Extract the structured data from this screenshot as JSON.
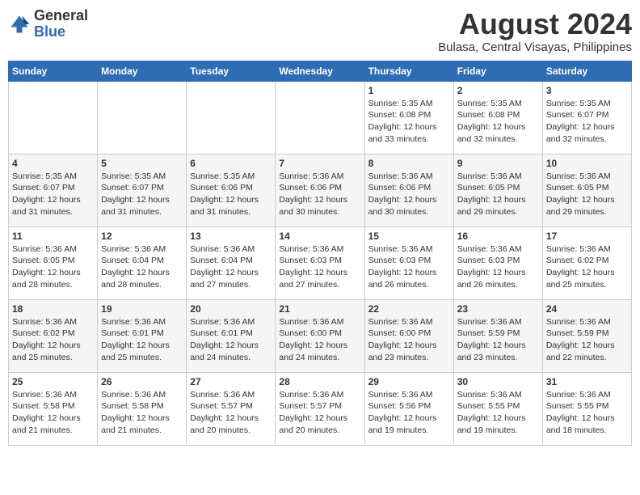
{
  "logo": {
    "general": "General",
    "blue": "Blue"
  },
  "title": "August 2024",
  "subtitle": "Bulasa, Central Visayas, Philippines",
  "days_of_week": [
    "Sunday",
    "Monday",
    "Tuesday",
    "Wednesday",
    "Thursday",
    "Friday",
    "Saturday"
  ],
  "weeks": [
    [
      {
        "day": "",
        "info": ""
      },
      {
        "day": "",
        "info": ""
      },
      {
        "day": "",
        "info": ""
      },
      {
        "day": "",
        "info": ""
      },
      {
        "day": "1",
        "info": "Sunrise: 5:35 AM\nSunset: 6:08 PM\nDaylight: 12 hours\nand 33 minutes."
      },
      {
        "day": "2",
        "info": "Sunrise: 5:35 AM\nSunset: 6:08 PM\nDaylight: 12 hours\nand 32 minutes."
      },
      {
        "day": "3",
        "info": "Sunrise: 5:35 AM\nSunset: 6:07 PM\nDaylight: 12 hours\nand 32 minutes."
      }
    ],
    [
      {
        "day": "4",
        "info": "Sunrise: 5:35 AM\nSunset: 6:07 PM\nDaylight: 12 hours\nand 31 minutes."
      },
      {
        "day": "5",
        "info": "Sunrise: 5:35 AM\nSunset: 6:07 PM\nDaylight: 12 hours\nand 31 minutes."
      },
      {
        "day": "6",
        "info": "Sunrise: 5:35 AM\nSunset: 6:06 PM\nDaylight: 12 hours\nand 31 minutes."
      },
      {
        "day": "7",
        "info": "Sunrise: 5:36 AM\nSunset: 6:06 PM\nDaylight: 12 hours\nand 30 minutes."
      },
      {
        "day": "8",
        "info": "Sunrise: 5:36 AM\nSunset: 6:06 PM\nDaylight: 12 hours\nand 30 minutes."
      },
      {
        "day": "9",
        "info": "Sunrise: 5:36 AM\nSunset: 6:05 PM\nDaylight: 12 hours\nand 29 minutes."
      },
      {
        "day": "10",
        "info": "Sunrise: 5:36 AM\nSunset: 6:05 PM\nDaylight: 12 hours\nand 29 minutes."
      }
    ],
    [
      {
        "day": "11",
        "info": "Sunrise: 5:36 AM\nSunset: 6:05 PM\nDaylight: 12 hours\nand 28 minutes."
      },
      {
        "day": "12",
        "info": "Sunrise: 5:36 AM\nSunset: 6:04 PM\nDaylight: 12 hours\nand 28 minutes."
      },
      {
        "day": "13",
        "info": "Sunrise: 5:36 AM\nSunset: 6:04 PM\nDaylight: 12 hours\nand 27 minutes."
      },
      {
        "day": "14",
        "info": "Sunrise: 5:36 AM\nSunset: 6:03 PM\nDaylight: 12 hours\nand 27 minutes."
      },
      {
        "day": "15",
        "info": "Sunrise: 5:36 AM\nSunset: 6:03 PM\nDaylight: 12 hours\nand 26 minutes."
      },
      {
        "day": "16",
        "info": "Sunrise: 5:36 AM\nSunset: 6:03 PM\nDaylight: 12 hours\nand 26 minutes."
      },
      {
        "day": "17",
        "info": "Sunrise: 5:36 AM\nSunset: 6:02 PM\nDaylight: 12 hours\nand 25 minutes."
      }
    ],
    [
      {
        "day": "18",
        "info": "Sunrise: 5:36 AM\nSunset: 6:02 PM\nDaylight: 12 hours\nand 25 minutes."
      },
      {
        "day": "19",
        "info": "Sunrise: 5:36 AM\nSunset: 6:01 PM\nDaylight: 12 hours\nand 25 minutes."
      },
      {
        "day": "20",
        "info": "Sunrise: 5:36 AM\nSunset: 6:01 PM\nDaylight: 12 hours\nand 24 minutes."
      },
      {
        "day": "21",
        "info": "Sunrise: 5:36 AM\nSunset: 6:00 PM\nDaylight: 12 hours\nand 24 minutes."
      },
      {
        "day": "22",
        "info": "Sunrise: 5:36 AM\nSunset: 6:00 PM\nDaylight: 12 hours\nand 23 minutes."
      },
      {
        "day": "23",
        "info": "Sunrise: 5:36 AM\nSunset: 5:59 PM\nDaylight: 12 hours\nand 23 minutes."
      },
      {
        "day": "24",
        "info": "Sunrise: 5:36 AM\nSunset: 5:59 PM\nDaylight: 12 hours\nand 22 minutes."
      }
    ],
    [
      {
        "day": "25",
        "info": "Sunrise: 5:36 AM\nSunset: 5:58 PM\nDaylight: 12 hours\nand 21 minutes."
      },
      {
        "day": "26",
        "info": "Sunrise: 5:36 AM\nSunset: 5:58 PM\nDaylight: 12 hours\nand 21 minutes."
      },
      {
        "day": "27",
        "info": "Sunrise: 5:36 AM\nSunset: 5:57 PM\nDaylight: 12 hours\nand 20 minutes."
      },
      {
        "day": "28",
        "info": "Sunrise: 5:36 AM\nSunset: 5:57 PM\nDaylight: 12 hours\nand 20 minutes."
      },
      {
        "day": "29",
        "info": "Sunrise: 5:36 AM\nSunset: 5:56 PM\nDaylight: 12 hours\nand 19 minutes."
      },
      {
        "day": "30",
        "info": "Sunrise: 5:36 AM\nSunset: 5:55 PM\nDaylight: 12 hours\nand 19 minutes."
      },
      {
        "day": "31",
        "info": "Sunrise: 5:36 AM\nSunset: 5:55 PM\nDaylight: 12 hours\nand 18 minutes."
      }
    ]
  ]
}
